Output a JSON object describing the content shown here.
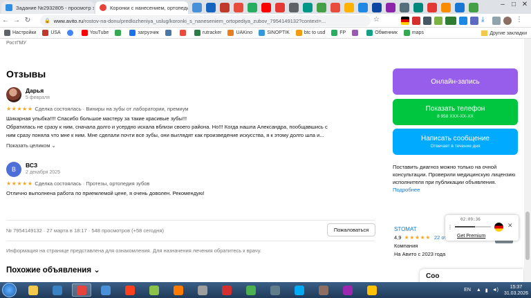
{
  "browser": {
    "tabs": [
      {
        "title": "Задание №2932805 - просмотр з",
        "favicon_color": "#2f8de4"
      },
      {
        "title": "Коронки с нанесением, ортопедия",
        "favicon_color": "#e8433b"
      }
    ],
    "url_host": "www.avito.ru",
    "url_path": "/rostov-na-donu/predlozheniya_uslug/koronki_s_naneseniem_ortopediya_zubov_7954149132?context=...",
    "bookmarks": [
      {
        "label": "Настройки",
        "color": "#5f6368"
      },
      {
        "label": "USA",
        "color": "#c0392b"
      },
      {
        "label": "",
        "color": "#4285f4"
      },
      {
        "label": "YouTube",
        "color": "#ff0000"
      },
      {
        "label": "",
        "color": "#34a853"
      },
      {
        "label": "загрузчик",
        "color": "#1a73e8"
      },
      {
        "label": "",
        "color": "#4a76a8"
      },
      {
        "label": "",
        "color": "#e74c3c"
      },
      {
        "label": "rutracker",
        "color": "#2d7d46"
      },
      {
        "label": "UAKino",
        "color": "#e67e22"
      },
      {
        "label": "SINOPTIK",
        "color": "#3498db"
      },
      {
        "label": "btc to usd",
        "color": "#f39c12"
      },
      {
        "label": "FP",
        "color": "#27ae60"
      },
      {
        "label": "",
        "color": "#9b59b6"
      },
      {
        "label": "Обменник",
        "color": "#16a085"
      },
      {
        "label": "maps",
        "color": "#34a853"
      }
    ],
    "other_bookmarks": "Другие закладки"
  },
  "page": {
    "prev_text": "РостГМУ",
    "reviews_title": "Отзывы",
    "reviews": [
      {
        "initial": "",
        "name": "Дарья",
        "date": "5 февраля",
        "stars": "★★★★★",
        "meta": "Сделка состоялась · Виниры на зубы от лаборатории, премиум",
        "lines": [
          "Шикарная улыбка!!!! Спасибо большое мастеру за такие красивые зубы!!!",
          "Обратилась не сразу к ним, сначала долго и усердно искала вблизи своего района. Но!!! Когда нашла Александра, пообщавшись с",
          "ним сразу поняла что мне к ним. Мне сделали почти все зубы, они выглядят как произведение искусства, я к этому долго шла и..."
        ],
        "show_more": "Показать целиком ⌄"
      },
      {
        "initial": "В",
        "name": "ВСЗ",
        "date": "2 декабря 2025",
        "stars": "★★★★★",
        "meta": "Сделка состоялась · Протезы, ортопедия зубов",
        "lines": [
          "Отлично выполнена работа по приемлемой цене, я очень доволен. Рекомендую!"
        ],
        "show_more": ""
      }
    ],
    "listing_info": "№ 7954149132 · 27 марта в 18:17 · 548 просмотров (+58 сегодня)",
    "complain_label": "Пожаловаться",
    "disclaimer": "Информация на странице представлена для ознакомления. Для назначения лечения обратитесь к врачу.",
    "similar_title": "Похожие объявления ⌄"
  },
  "sidebar": {
    "online_booking": "Онлайн-запись",
    "show_phone": "Показать телефон",
    "phone_masked": "8 958 XXX-XX-XX",
    "write_message": "Написать сообщение",
    "reply_time": "Отвечает в течение дня",
    "note": "Поставить диагноз можно только на очной консультации. Проверили медицинскую лицензию исполнителя при публикации объявления.",
    "note_link": "Подробнее",
    "seller": {
      "name": "STOMAT",
      "rating": "4,9",
      "stars": "★★★★★",
      "reviews_link": "22 отзыва",
      "type": "Компания",
      "since": "На Авито с 2023 года"
    },
    "partial_button": "Соо"
  },
  "media_popup": {
    "time": "02:09:36",
    "progress": 0.55,
    "premium_link": "Get Premium"
  },
  "taskbar": {
    "apps": [
      {
        "name": "explorer",
        "color": "#f2c94c"
      },
      {
        "name": "wmp",
        "color": "#3b82c4"
      },
      {
        "name": "chrome",
        "color": "#e8433b"
      },
      {
        "name": "globe",
        "color": "#4a90d9"
      },
      {
        "name": "yandex",
        "color": "#fc3f1d"
      },
      {
        "name": "monitor",
        "color": "#8bc34a"
      },
      {
        "name": "media",
        "color": "#ff7a00"
      },
      {
        "name": "disk",
        "color": "#9e9e9e"
      },
      {
        "name": "64",
        "color": "#d32f2f"
      },
      {
        "name": "app10",
        "color": "#4caf50"
      },
      {
        "name": "app11",
        "color": "#607d8b"
      },
      {
        "name": "app12",
        "color": "#03a9f4"
      },
      {
        "name": "app13",
        "color": "#8d6e63"
      },
      {
        "name": "app14",
        "color": "#9c27b0"
      },
      {
        "name": "app15",
        "color": "#ffc107"
      }
    ],
    "lang": "EN",
    "time": "15:37",
    "date": "31.03.2026"
  }
}
